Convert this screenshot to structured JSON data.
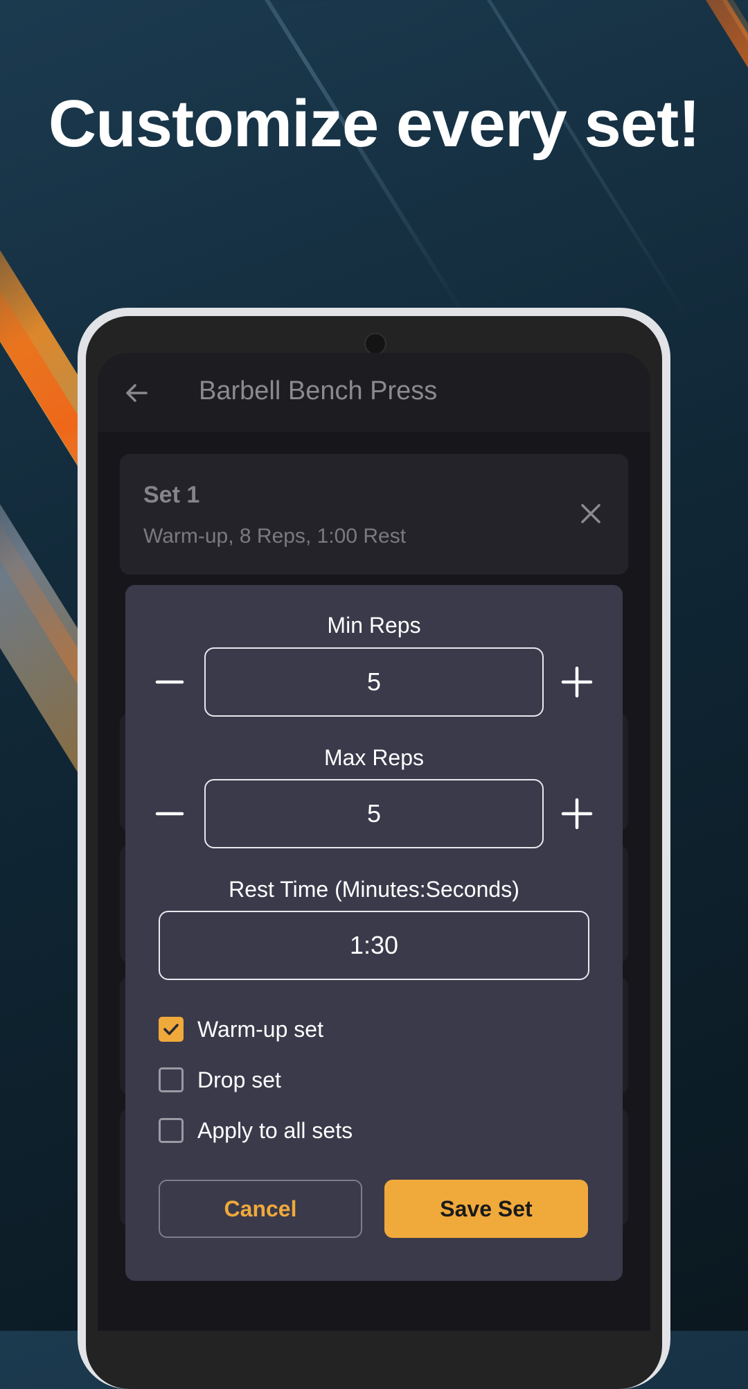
{
  "headline": "Customize every set!",
  "appbar": {
    "title": "Barbell Bench Press"
  },
  "set_card": {
    "title": "Set 1",
    "summary": "Warm-up, 8 Reps, 1:00 Rest"
  },
  "dialog": {
    "min_reps": {
      "label": "Min Reps",
      "value": "5"
    },
    "max_reps": {
      "label": "Max Reps",
      "value": "5"
    },
    "rest_time": {
      "label": "Rest Time (Minutes:Seconds)",
      "value": "1:30"
    },
    "options": [
      {
        "label": "Warm-up set",
        "checked": true
      },
      {
        "label": "Drop set",
        "checked": false
      },
      {
        "label": "Apply to all sets",
        "checked": false
      }
    ],
    "cancel_label": "Cancel",
    "save_label": "Save Set"
  },
  "icons": {
    "back": "arrow-left-icon",
    "close": "close-icon",
    "minus": "minus-icon",
    "plus": "plus-icon",
    "check": "checkmark-icon"
  },
  "colors": {
    "accent": "#f0a93b",
    "dialog_bg": "#3b3a4b",
    "screen_bg": "#17171b"
  }
}
